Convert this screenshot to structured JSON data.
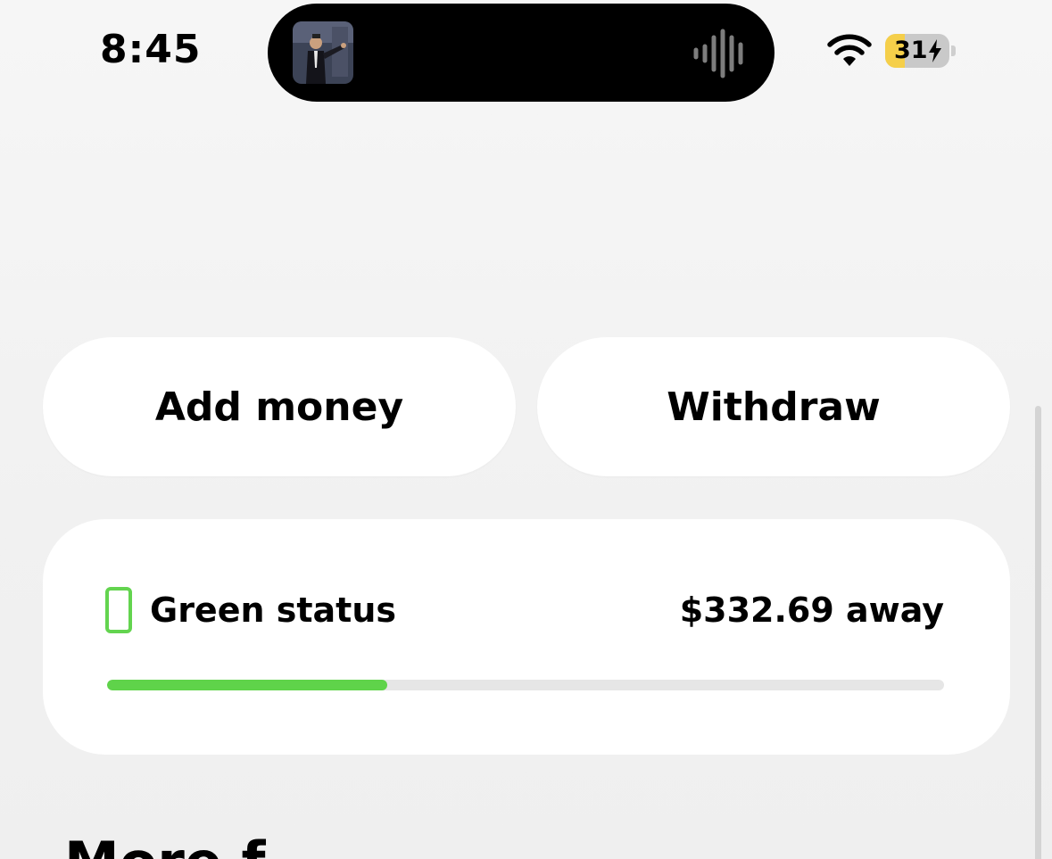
{
  "status_bar": {
    "time": "8:45",
    "battery_percent": 31,
    "battery_label": "31",
    "icons": [
      "now-playing-art",
      "waveform-icon",
      "wifi-icon",
      "battery-charging-icon"
    ]
  },
  "actions": {
    "add_money_label": "Add money",
    "withdraw_label": "Withdraw"
  },
  "status_card": {
    "label": "Green status",
    "away_text": "$332.69 away",
    "progress_fraction": 0.335,
    "accent_color": "#5fd34a"
  },
  "section": {
    "heading": "More f"
  },
  "colors": {
    "background": "#f3f3f3",
    "card": "#ffffff",
    "text": "#000000",
    "accent_green": "#5fd34a",
    "battery_yellow": "#f5cf4a"
  }
}
